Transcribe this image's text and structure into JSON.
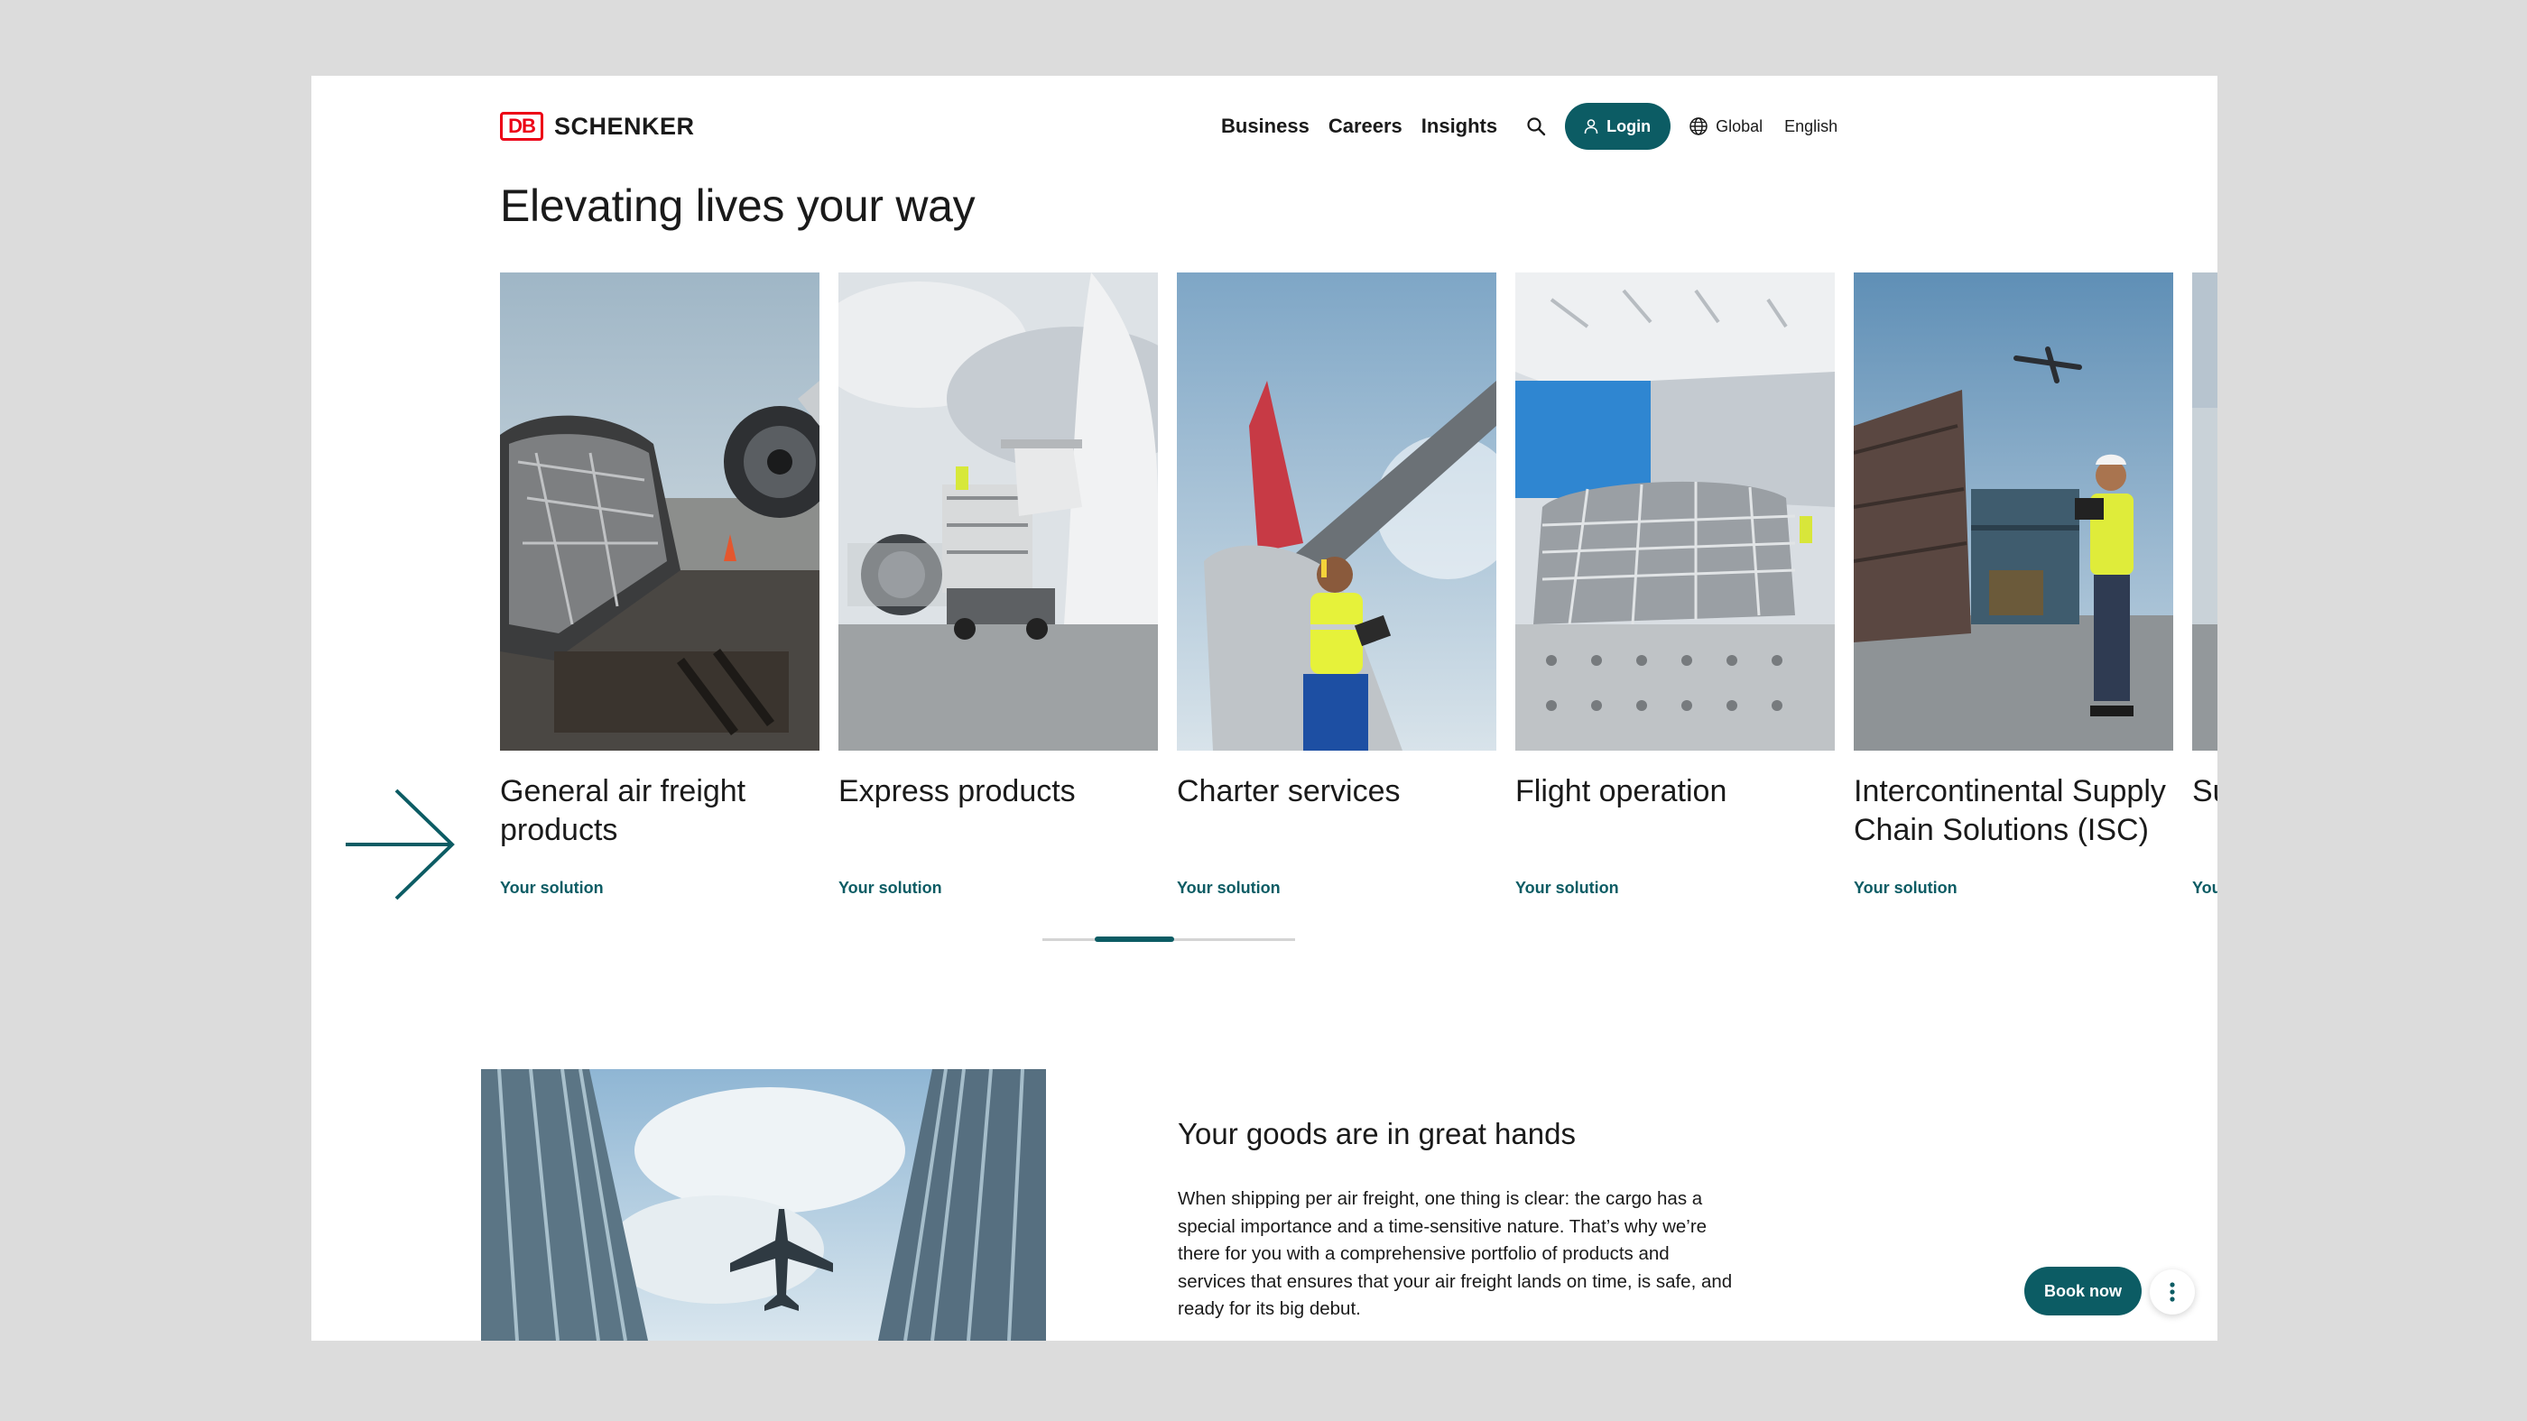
{
  "header": {
    "logo_mark": "DB",
    "logo_name": "SCHENKER",
    "nav": [
      "Business",
      "Careers",
      "Insights"
    ],
    "login_label": "Login",
    "region_label": "Global",
    "language_label": "English"
  },
  "page_title": "Elevating lives your way",
  "cards": [
    {
      "title": "General air freight products",
      "link": "Your solution"
    },
    {
      "title": "Express products",
      "link": "Your solution"
    },
    {
      "title": "Charter services",
      "link": "Your solution"
    },
    {
      "title": "Flight operation",
      "link": "Your solution"
    },
    {
      "title": "Intercontinental Supply Chain Solutions (ISC)",
      "link": "Your solution"
    },
    {
      "title": "Supply chain freight",
      "link": "Your solution"
    }
  ],
  "carousel": {
    "progress": 0.3
  },
  "section": {
    "title": "Your goods are in great hands",
    "body": "When shipping per air freight, one thing is clear: the cargo has a special importance and a time-sensitive nature. That’s why we’re there for you with a comprehensive portfolio of products and services that ensures that your air freight lands on time, is safe, and ready for its big debut."
  },
  "floating": {
    "book_label": "Book now"
  },
  "icons": {
    "search": "search-icon",
    "user": "user-icon",
    "globe": "globe-icon",
    "next": "arrow-right-icon",
    "more": "more-vertical-icon"
  },
  "colors": {
    "brand_red": "#ec0016",
    "accent_teal": "#0c5c64"
  }
}
